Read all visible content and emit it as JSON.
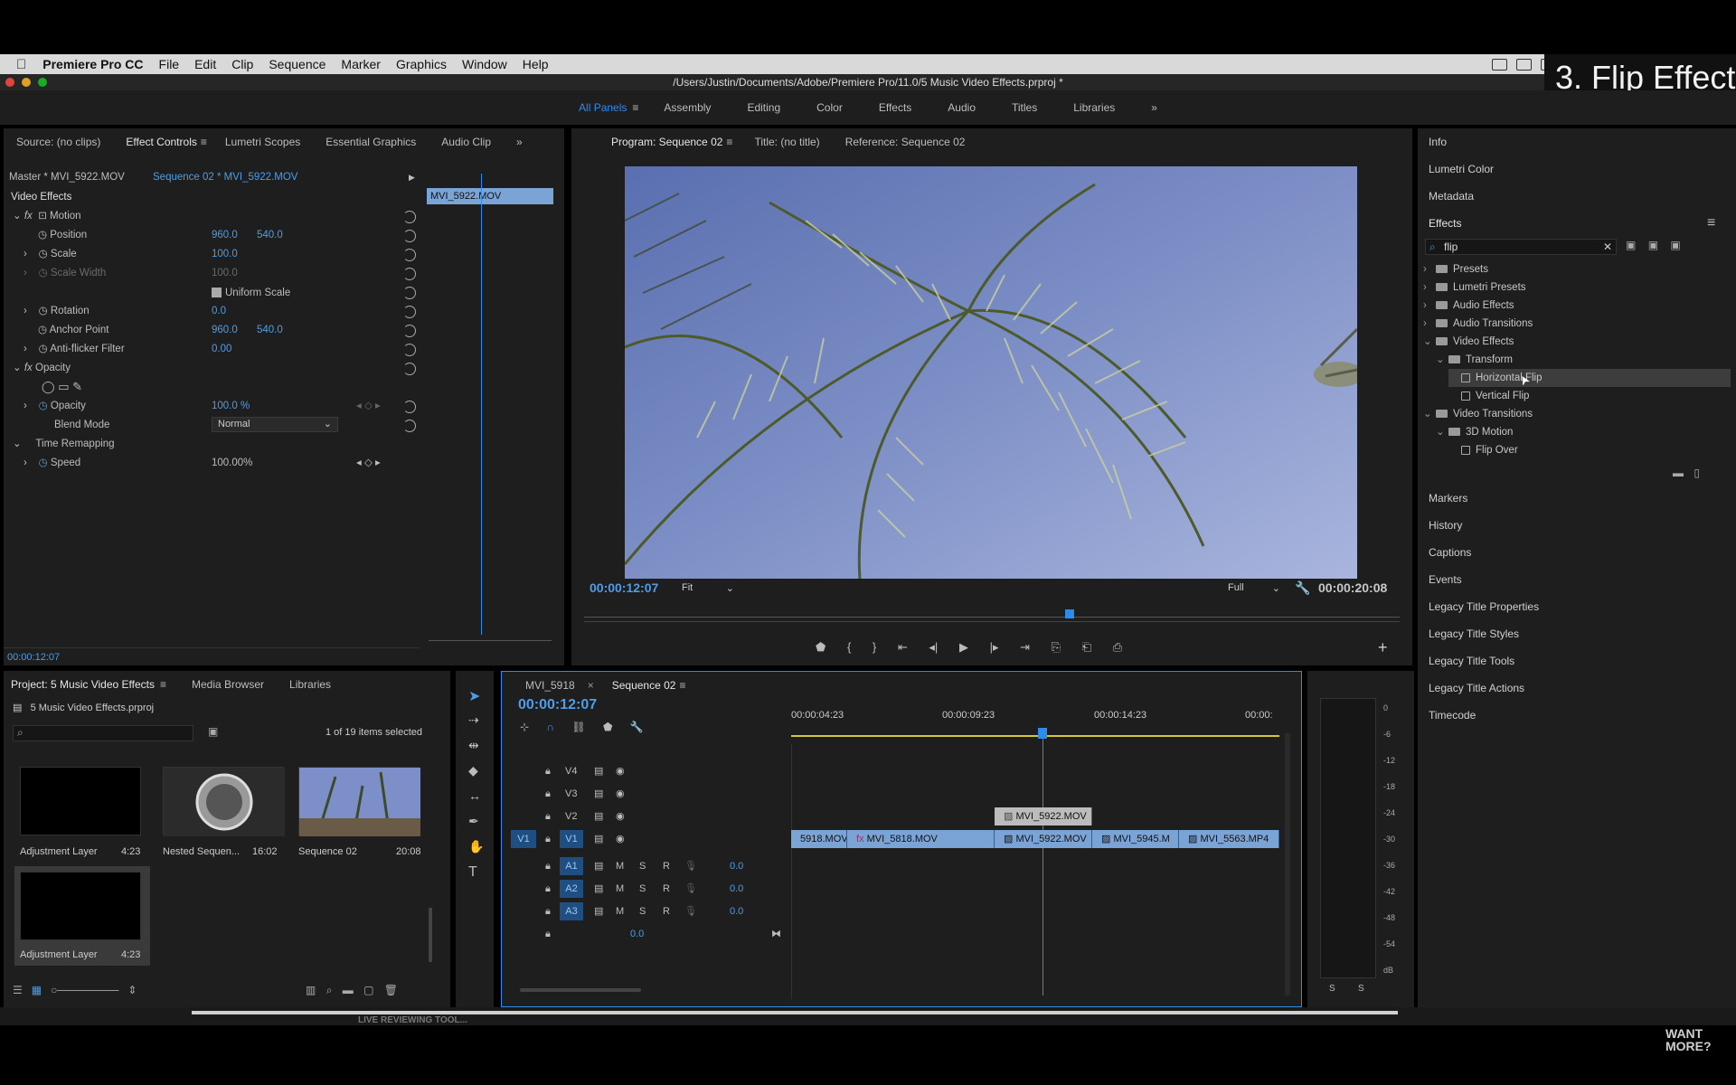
{
  "menubar": {
    "apple": "",
    "app": "Premiere Pro CC",
    "items": [
      "File",
      "Edit",
      "Clip",
      "Sequence",
      "Marker",
      "Graphics",
      "Window",
      "Help"
    ]
  },
  "window": {
    "path": "/Users/Justin/Documents/Adobe/Premiere Pro/11.0/5 Music Video Effects.prproj *"
  },
  "overlay": {
    "title": "3. Flip Effect",
    "watermark": "WANT MORE?",
    "caption": "LIVE REVIEWING TOOL..."
  },
  "workspaces": {
    "items": [
      "All Panels",
      "Assembly",
      "Editing",
      "Color",
      "Effects",
      "Audio",
      "Titles",
      "Libraries"
    ],
    "more": "»"
  },
  "effect_controls": {
    "tabs": [
      "Source: (no clips)",
      "Effect Controls",
      "Lumetri Scopes",
      "Essential Graphics",
      "Audio Clip"
    ],
    "master": "Master * MVI_5922.MOV",
    "sequence": "Sequence 02 * MVI_5922.MOV",
    "clip": "MVI_5922.MOV",
    "video_effects": "Video Effects",
    "motion": "Motion",
    "position_label": "Position",
    "position_x": "960.0",
    "position_y": "540.0",
    "scale_label": "Scale",
    "scale_val": "100.0",
    "scale_width_label": "Scale Width",
    "scale_width_val": "100.0",
    "uniform_scale": "Uniform Scale",
    "rotation_label": "Rotation",
    "rotation_val": "0.0",
    "anchor_label": "Anchor Point",
    "anchor_x": "960.0",
    "anchor_y": "540.0",
    "antiflicker_label": "Anti-flicker Filter",
    "antiflicker_val": "0.00",
    "opacity_section": "Opacity",
    "opacity_label": "Opacity",
    "opacity_val": "100.0 %",
    "blend_label": "Blend Mode",
    "blend_val": "Normal",
    "time_remap": "Time Remapping",
    "speed_label": "Speed",
    "speed_val": "100.00%",
    "timecode": "00:00:12:07",
    "fx": "fx"
  },
  "program": {
    "tabs": [
      "Program: Sequence 02",
      "Title: (no title)",
      "Reference: Sequence 02"
    ],
    "timecode": "00:00:12:07",
    "fit": "Fit",
    "quality": "Full",
    "duration": "00:00:20:08"
  },
  "right_panels": {
    "top": [
      "Info",
      "Lumetri Color",
      "Metadata"
    ],
    "effects_title": "Effects",
    "search": "flip",
    "tree": [
      {
        "label": "Presets",
        "level": 0,
        "open": false
      },
      {
        "label": "Lumetri Presets",
        "level": 0,
        "open": false
      },
      {
        "label": "Audio Effects",
        "level": 0,
        "open": false
      },
      {
        "label": "Audio Transitions",
        "level": 0,
        "open": false
      },
      {
        "label": "Video Effects",
        "level": 0,
        "open": true
      },
      {
        "label": "Transform",
        "level": 1,
        "open": true
      },
      {
        "label": "Horizontal Flip",
        "level": 2,
        "open": false
      },
      {
        "label": "Vertical Flip",
        "level": 2,
        "open": false
      },
      {
        "label": "Video Transitions",
        "level": 0,
        "open": true
      },
      {
        "label": "3D Motion",
        "level": 1,
        "open": true
      },
      {
        "label": "Flip Over",
        "level": 2,
        "open": false
      }
    ],
    "bottom": [
      "Markers",
      "History",
      "Captions",
      "Events",
      "Legacy Title Properties",
      "Legacy Title Styles",
      "Legacy Title Tools",
      "Legacy Title Actions",
      "Timecode"
    ]
  },
  "project": {
    "tabs": [
      "Project: 5 Music Video Effects",
      "Media Browser",
      "Libraries"
    ],
    "file": "5 Music Video Effects.prproj",
    "selection": "1 of 19 items selected",
    "items": [
      {
        "name": "Adjustment Layer",
        "duration": "4:23"
      },
      {
        "name": "Nested Sequen...",
        "duration": "16:02"
      },
      {
        "name": "Sequence 02",
        "duration": "20:08"
      },
      {
        "name": "Adjustment Layer",
        "duration": "4:23"
      }
    ]
  },
  "timeline": {
    "tabs": [
      "MVI_5918",
      "Sequence 02"
    ],
    "timecode": "00:00:12:07",
    "ruler": [
      "00:00:04:23",
      "00:00:09:23",
      "00:00:14:23",
      "00:00:"
    ],
    "video_tracks": [
      "V4",
      "V3",
      "V2",
      "V1"
    ],
    "audio_tracks": [
      "A1",
      "A2",
      "A3"
    ],
    "source_patch": "V1",
    "audio_vol": "0.0",
    "master_vol": "0.0",
    "m": "M",
    "s": "S",
    "r": "R",
    "v2_clip": "MVI_5922.MOV",
    "v1_clips": [
      "5918.MOV",
      "MVI_5818.MOV",
      "MVI_5922.MOV",
      "MVI_5945.M",
      "MVI_5563.MP4"
    ]
  },
  "meters": {
    "scale": [
      "0",
      "-6",
      "-12",
      "-18",
      "-24",
      "-30",
      "-36",
      "-42",
      "-48",
      "-54",
      "dB"
    ],
    "solo": "S"
  }
}
